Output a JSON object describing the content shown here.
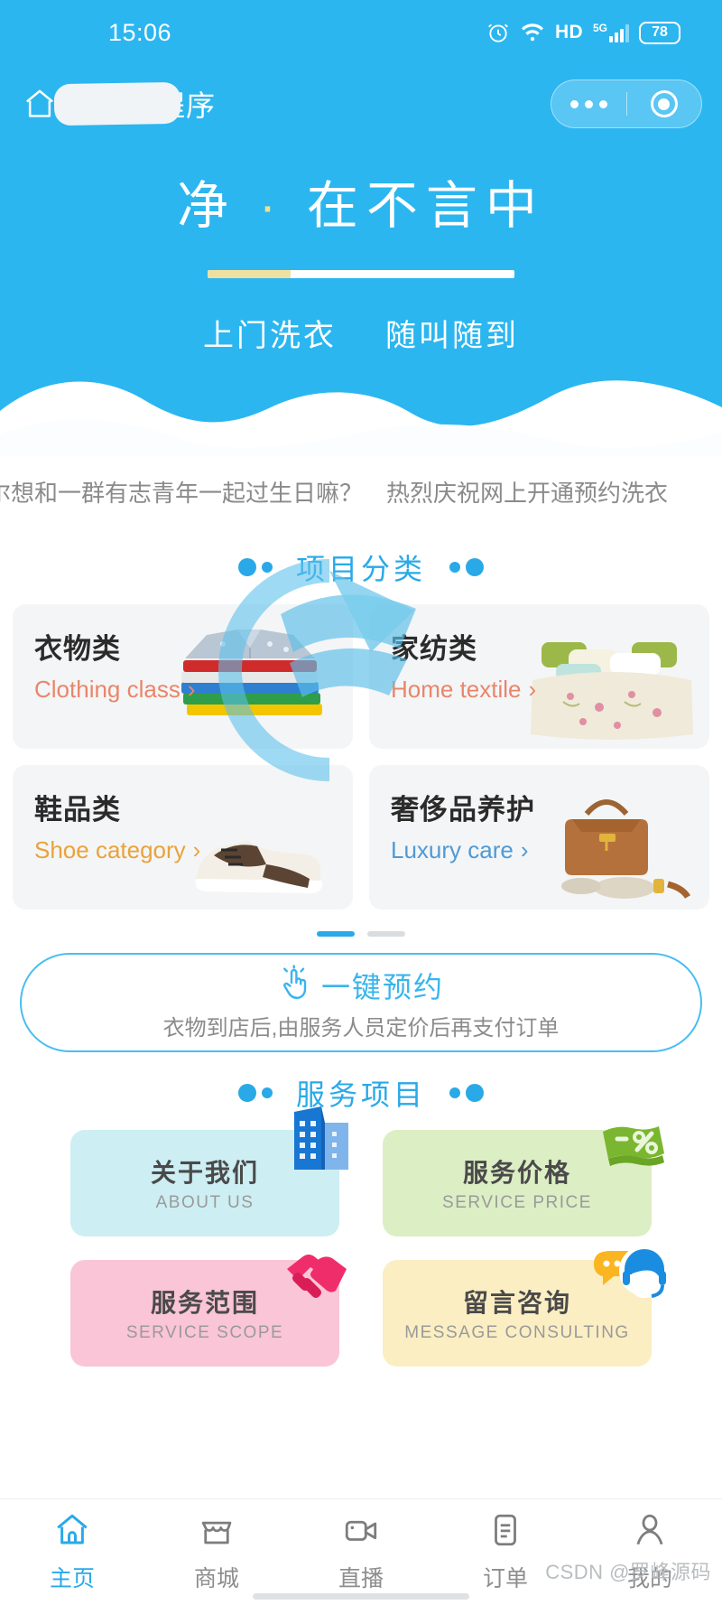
{
  "status_bar": {
    "time": "15:06",
    "hd_label": "HD",
    "network_label": "5G",
    "battery_level": "78",
    "icons": [
      "alarm-clock-icon",
      "wifi-icon",
      "hd-icon",
      "signal-bars-icon",
      "battery-icon"
    ]
  },
  "app_bar": {
    "title": "洗衣小程序",
    "home_icon": "home-icon",
    "menu_icon": "more-dots-icon",
    "close_icon": "target-circle-icon"
  },
  "hero": {
    "slogan_part1": "净",
    "slogan_dot": "·",
    "slogan_part2": "在不言中",
    "sub_left": "上门洗衣",
    "sub_right": "随叫随到",
    "progress_percent": 27
  },
  "notice": {
    "text": "尔想和一群有志青年一起过生日嘛？",
    "text2": "热烈庆祝网上开通预约洗衣"
  },
  "categories_section": {
    "title": "项目分类",
    "items": [
      {
        "cn": "衣物类",
        "en": "Clothing class",
        "chevron": "›",
        "accent": "#e8866a",
        "art": "folded-clothes-image"
      },
      {
        "cn": "家纺类",
        "en": "Home textile",
        "chevron": "›",
        "accent": "#e8866a",
        "art": "bedding-image"
      },
      {
        "cn": "鞋品类",
        "en": "Shoe category",
        "chevron": "›",
        "accent": "#e8a33c",
        "art": "sneakers-image"
      },
      {
        "cn": "奢侈品养护",
        "en": "Luxury care",
        "chevron": "›",
        "accent": "#4f9ad6",
        "art": "handbag-image"
      }
    ],
    "pager": {
      "total": 2,
      "active_index": 0
    }
  },
  "book_button": {
    "label": "一键预约",
    "sub": "衣物到店后,由服务人员定价后再支付订单",
    "icon": "tap-finger-icon"
  },
  "services_section": {
    "title": "服务项目",
    "items": [
      {
        "cn": "关于我们",
        "en": "ABOUT US",
        "bg": "#cdeef2",
        "icon": "office-building-icon",
        "icon_color": "#1877d2"
      },
      {
        "cn": "服务价格",
        "en": "SERVICE PRICE",
        "bg": "#dceec4",
        "icon": "discount-tag-icon",
        "icon_color": "#7ab62f"
      },
      {
        "cn": "服务范围",
        "en": "SERVICE SCOPE",
        "bg": "#fac5d6",
        "icon": "handshake-icon",
        "icon_color": "#ef2d6a"
      },
      {
        "cn": "留言咨询",
        "en": "MESSAGE CONSULTING",
        "bg": "#fbeec2",
        "icon": "customer-service-icon",
        "icon_color": "#f5b battle"
      }
    ]
  },
  "tab_bar": {
    "items": [
      {
        "label": "主页",
        "icon": "home-icon",
        "active": true
      },
      {
        "label": "商城",
        "icon": "shop-icon",
        "active": false
      },
      {
        "label": "直播",
        "icon": "video-camera-icon",
        "active": false
      },
      {
        "label": "订单",
        "icon": "order-list-icon",
        "active": false
      },
      {
        "label": "我的",
        "icon": "person-icon",
        "active": false
      }
    ]
  },
  "watermark": "CSDN @罗峰源码",
  "colors": {
    "brand_blue": "#2bb6f0",
    "accent_blue": "#29a9e8",
    "card_gray": "#f4f5f6"
  }
}
